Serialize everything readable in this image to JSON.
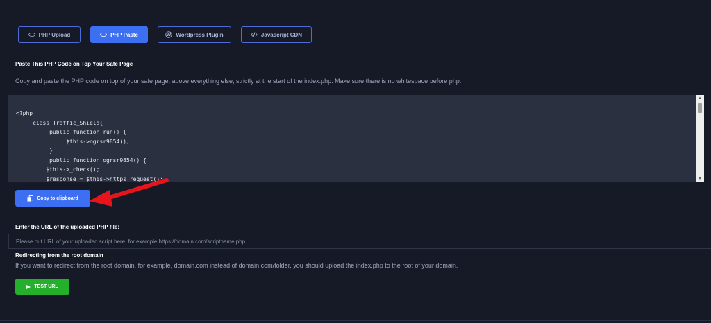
{
  "tabs": [
    {
      "label": "PHP Upload",
      "icon": "php-icon",
      "active": false
    },
    {
      "label": "PHP Paste",
      "icon": "php-icon",
      "active": true
    },
    {
      "label": "Wordpress Plugin",
      "icon": "wordpress-icon",
      "active": false
    },
    {
      "label": "Javascript CDN",
      "icon": "code-icon",
      "active": false
    }
  ],
  "paste_section": {
    "title": "Paste This PHP Code on Top Your Safe Page",
    "instructions": "Copy and paste the PHP code on top of your safe page, above everything else, strictly at the start of the index.php. Make sure there is no whitespace before php.",
    "code": "<?php\n\tclass Traffic_Shield{\n\t\tpublic function run() {\n\t\t\t$this->ogrsr9854();\n\t\t}\n\t\tpublic function ogrsr9854() {\n\t    $this->_check();\n\t    $response = $this->https_request();"
  },
  "copy_button": {
    "label": "Copy to clipboard",
    "icon": "copy-icon"
  },
  "url_section": {
    "label": "Enter the URL of the uploaded PHP file:",
    "placeholder": "Please put URL of your uploaded script here, for example https://domain.com/scriptname.php"
  },
  "redirect_section": {
    "title": "Redirecting from the root domain",
    "text": "If you want to redirect from the root domain, for example, domain.com instead of domain.com/folder, you should upload the index.php to the root of your domain."
  },
  "test_button": {
    "label": "TEST URL",
    "icon": "play-icon"
  },
  "colors": {
    "background": "#161a27",
    "accent": "#3d6ff2",
    "success": "#25b02b",
    "annotation_arrow": "#e8141b"
  }
}
